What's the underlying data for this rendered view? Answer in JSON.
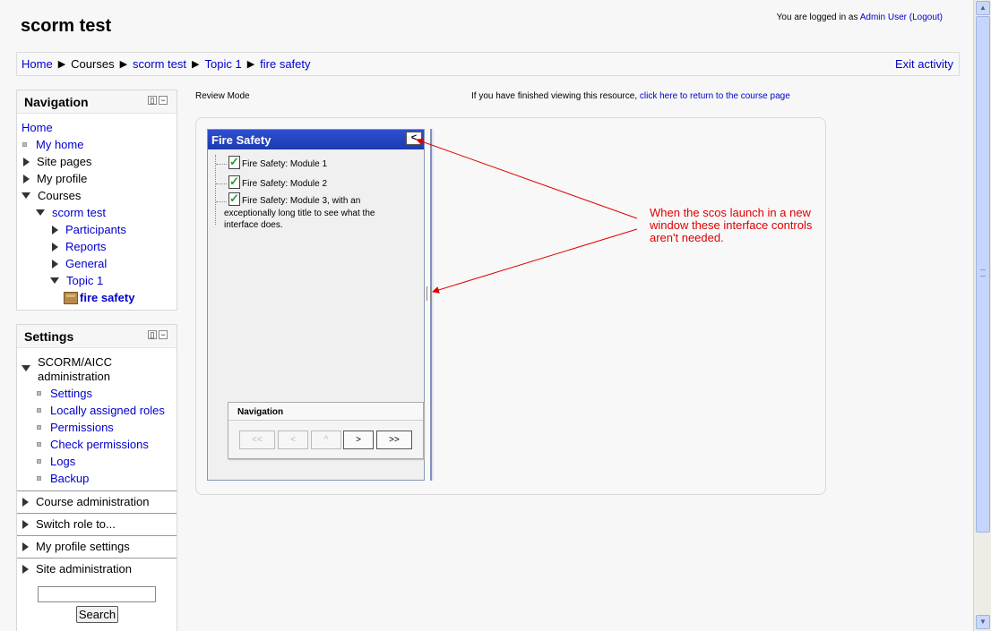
{
  "header": {
    "site_title": "scorm test",
    "login_prefix": "You are logged in as ",
    "login_user": "Admin User",
    "logout": "(Logout)"
  },
  "breadcrumb": {
    "items": [
      "Home",
      "Courses",
      "scorm test",
      "Topic 1",
      "fire safety"
    ],
    "separator": "▶",
    "exit_activity": "Exit activity"
  },
  "navigation_block": {
    "title": "Navigation",
    "items": [
      "Home",
      "My home",
      "Site pages",
      "My profile",
      "Courses",
      "scorm test",
      "Participants",
      "Reports",
      "General",
      "Topic 1",
      "fire safety"
    ]
  },
  "settings_block": {
    "title": "Settings",
    "scorm_admin": [
      "SCORM/AICC",
      "administration"
    ],
    "scorm_items": [
      "Settings",
      "Locally assigned roles",
      "Permissions",
      "Check permissions",
      "Logs",
      "Backup"
    ],
    "sections": [
      "Course administration",
      "Switch role to...",
      "My profile settings",
      "Site administration"
    ],
    "search_button": "Search",
    "search_value": ""
  },
  "main": {
    "review_mode": "Review Mode",
    "finished_text": "If you have finished viewing this resource, ",
    "return_link": "click here to return to the course page"
  },
  "toc": {
    "title": "Fire Safety",
    "collapse_glyph": "<",
    "modules": [
      "Fire Safety: Module 1",
      "Fire Safety: Module 2",
      "Fire Safety: Module 3, with an",
      "exceptionally long title to see what the",
      "interface does."
    ]
  },
  "scorm_nav": {
    "title": "Navigation",
    "buttons": [
      "<<",
      "<",
      "^",
      ">",
      ">>"
    ]
  },
  "annotation": {
    "lines": [
      "When the scos launch in a new",
      "window these interface controls",
      "aren't needed."
    ],
    "color": "#e00000"
  }
}
